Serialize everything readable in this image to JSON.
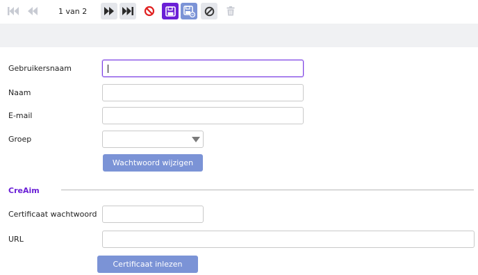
{
  "toolbar": {
    "page_info": "1 van 2",
    "icons": [
      "first-page-icon",
      "previous-page-icon",
      "next-page-icon",
      "last-page-icon",
      "cancel-icon",
      "save-icon",
      "save-as-icon",
      "disable-icon",
      "delete-icon"
    ],
    "colors": {
      "accent": "#6a1fd6",
      "secondary": "#7b93d6",
      "danger": "#e02020",
      "inactive": "#c8cbd3"
    }
  },
  "form": {
    "username_label": "Gebruikersnaam",
    "username_value": "",
    "name_label": "Naam",
    "name_value": "",
    "email_label": "E-mail",
    "email_value": "",
    "group_label": "Groep",
    "group_value": "",
    "change_password_button": "Wachtwoord wijzigen"
  },
  "creaim": {
    "section_title": "CreAim",
    "cert_password_label": "Certificaat wachtwoord",
    "cert_password_value": "",
    "url_label": "URL",
    "url_value": "",
    "read_certificate_button": "Certificaat inlezen"
  }
}
